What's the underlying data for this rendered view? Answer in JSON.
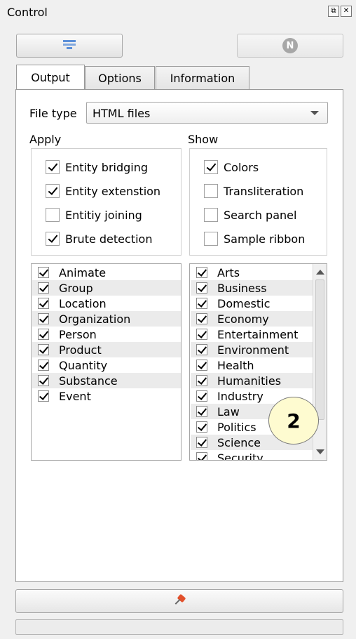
{
  "window": {
    "title": "Control",
    "float_icon": "float-icon",
    "close_icon": "close-icon"
  },
  "toolbar": {
    "left_button_icon": "document-lines-icon",
    "right_button_letter": "N"
  },
  "tabs": [
    {
      "label": "Output",
      "active": true
    },
    {
      "label": "Options",
      "active": false
    },
    {
      "label": "Information",
      "active": false
    }
  ],
  "output": {
    "file_type_label": "File type",
    "file_type_value": "HTML files",
    "apply": {
      "label": "Apply",
      "items": [
        {
          "label": "Entity bridging",
          "checked": true
        },
        {
          "label": "Entity extenstion",
          "checked": true
        },
        {
          "label": "Entitiy joining",
          "checked": false
        },
        {
          "label": "Brute detection",
          "checked": true
        }
      ]
    },
    "show": {
      "label": "Show",
      "items": [
        {
          "label": "Colors",
          "checked": true
        },
        {
          "label": "Transliteration",
          "checked": false
        },
        {
          "label": "Search panel",
          "checked": false
        },
        {
          "label": "Sample ribbon",
          "checked": false
        }
      ]
    },
    "entity_types": [
      {
        "label": "Animate",
        "checked": true
      },
      {
        "label": "Group",
        "checked": true
      },
      {
        "label": "Location",
        "checked": true
      },
      {
        "label": "Organization",
        "checked": true
      },
      {
        "label": "Person",
        "checked": true
      },
      {
        "label": "Product",
        "checked": true
      },
      {
        "label": "Quantity",
        "checked": true
      },
      {
        "label": "Substance",
        "checked": true
      },
      {
        "label": "Event",
        "checked": true
      }
    ],
    "topics": [
      {
        "label": "Arts",
        "checked": true
      },
      {
        "label": "Business",
        "checked": true
      },
      {
        "label": "Domestic",
        "checked": true
      },
      {
        "label": "Economy",
        "checked": true
      },
      {
        "label": "Entertainment",
        "checked": true
      },
      {
        "label": "Environment",
        "checked": true
      },
      {
        "label": "Health",
        "checked": true
      },
      {
        "label": "Humanities",
        "checked": true
      },
      {
        "label": "Industry",
        "checked": true
      },
      {
        "label": "Law",
        "checked": true
      },
      {
        "label": "Politics",
        "checked": true
      },
      {
        "label": "Science",
        "checked": true
      },
      {
        "label": "Security",
        "checked": true
      }
    ]
  },
  "callout": {
    "number": "2"
  },
  "bottom": {
    "button_icon": "pin-icon"
  },
  "colors": {
    "pin": "#e2502b",
    "doc_icon": "#5b8fd8",
    "callout_fill": "#fefbd0",
    "row_alt": "#ebebeb"
  }
}
